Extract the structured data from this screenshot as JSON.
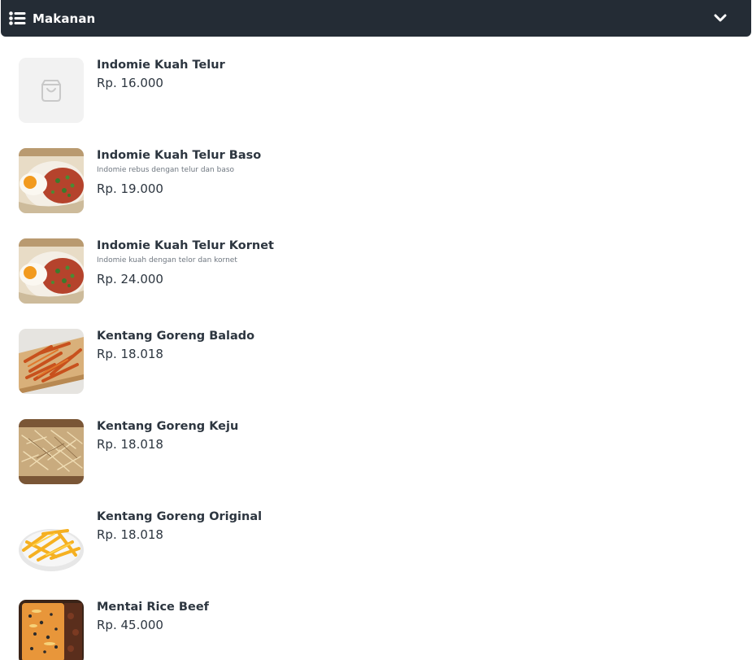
{
  "category": {
    "title": "Makanan",
    "list_icon": "list-icon",
    "toggle_icon": "chevron-down-icon"
  },
  "items": [
    {
      "name": "Indomie Kuah Telur",
      "price": "Rp. 16.000",
      "image": "shopping-bag-placeholder-icon"
    },
    {
      "name": "Indomie Kuah Telur Baso",
      "description": "Indomie rebus dengan telur dan baso",
      "price": "Rp. 19.000",
      "image": "fried-egg-noodle-photo"
    },
    {
      "name": "Indomie Kuah Telur Kornet",
      "description": "Indomie kuah dengan telor dan kornet",
      "price": "Rp. 24.000",
      "image": "fried-egg-noodle-photo"
    },
    {
      "name": "Kentang Goreng Balado",
      "price": "Rp. 18.018",
      "image": "balado-fries-photo"
    },
    {
      "name": "Kentang Goreng Keju",
      "price": "Rp. 18.018",
      "image": "cheese-fries-photo"
    },
    {
      "name": "Kentang Goreng Original",
      "price": "Rp. 18.018",
      "image": "original-fries-photo"
    },
    {
      "name": "Mentai Rice Beef",
      "price": "Rp. 45.000",
      "image": "mentai-rice-photo"
    }
  ],
  "colors": {
    "header_bg": "#242c35",
    "text_dark": "#2d3640",
    "text_muted": "#6f7780",
    "placeholder_bg": "#f2f2f2"
  }
}
